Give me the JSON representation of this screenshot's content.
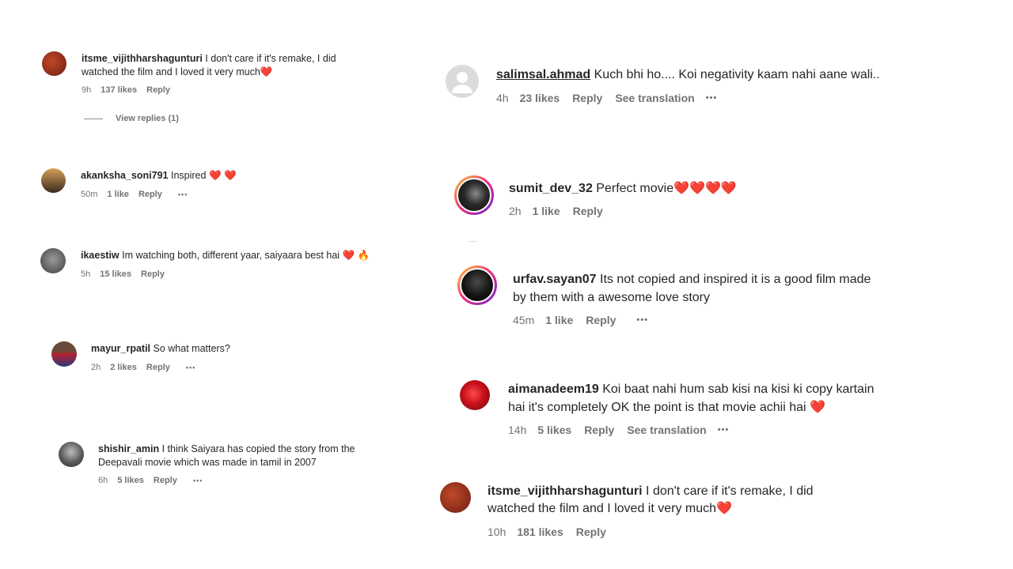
{
  "comments": [
    {
      "user": "itsme_vijithharshagunturi",
      "text": "I don't care if it's remake, I did watched the film and I loved it very much",
      "emoji": "❤️",
      "time": "9h",
      "likes": "137 likes",
      "reply": "Reply",
      "avatar_color": "#8a2a18"
    },
    {
      "user": "akanksha_soni791",
      "text": "Inspired",
      "emoji": "❤️ ❤️",
      "time": "50m",
      "likes": "1 like",
      "reply": "Reply",
      "more": "•••",
      "avatar_color": "#2b2622"
    },
    {
      "user": "ikaestiw",
      "text": "Im watching both, different yaar, saiyaara best hai",
      "emoji": "❤️ 🔥",
      "time": "5h",
      "likes": "15 likes",
      "reply": "Reply",
      "avatar_color": "#5b5b5b"
    },
    {
      "user": "mayur_rpatil",
      "text": "So what matters?",
      "time": "2h",
      "likes": "2 likes",
      "reply": "Reply",
      "more": "•••",
      "avatar_color": "#2a3a78"
    },
    {
      "user": "shishir_amin",
      "text": "I think Saiyara has copied the story from the Deepavali movie which was made in tamil in 2007",
      "time": "6h",
      "likes": "5 likes",
      "reply": "Reply",
      "more": "•••",
      "avatar_color": "#3a3a3a"
    },
    {
      "user": "salimsal.ahmad",
      "text": "Kuch bhi ho.... Koi negativity kaam nahi aane wali..",
      "time": "4h",
      "likes": "23 likes",
      "reply": "Reply",
      "translation": "See translation",
      "more": "•••",
      "avatar_color": "#dbdbdb"
    },
    {
      "user": "sumit_dev_32",
      "text": "Perfect movie",
      "emoji": "❤️❤️❤️❤️",
      "time": "2h",
      "likes": "1 like",
      "reply": "Reply",
      "avatar_color": "#1c1c1c"
    },
    {
      "user": "urfav.sayan07",
      "text": "Its not copied and inspired it is a good film made by them with a awesome love story",
      "time": "45m",
      "likes": "1 like",
      "reply": "Reply",
      "more": "•••",
      "avatar_color": "#111111"
    },
    {
      "user": "aimanadeem19",
      "text": "Koi baat nahi hum sab kisi na kisi ki copy kartain hai it's completely OK the point is that movie achii hai",
      "emoji": "❤️",
      "time": "14h",
      "likes": "5 likes",
      "reply": "Reply",
      "translation": "See translation",
      "more": "•••",
      "avatar_color": "#b5121b"
    },
    {
      "user": "itsme_vijithharshagunturi",
      "text": "I don't care if it's remake, I did watched the film and I loved it very much",
      "emoji": "❤️",
      "time": "10h",
      "likes": "181 likes",
      "reply": "Reply",
      "avatar_color": "#8a2a18"
    }
  ],
  "view_replies": "View replies (1)"
}
